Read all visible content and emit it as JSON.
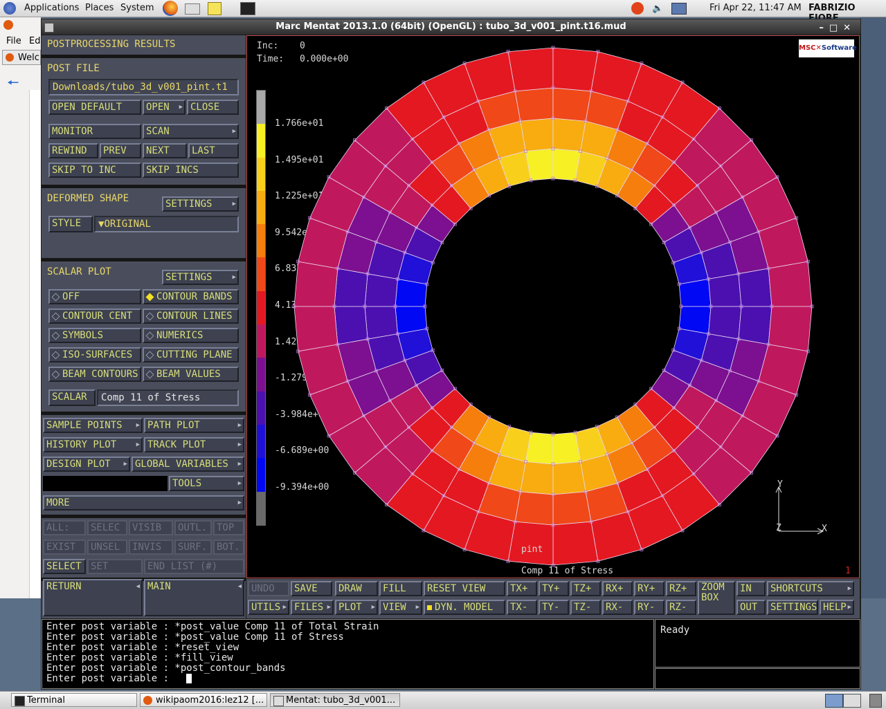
{
  "topbar": {
    "menus": [
      "Applications",
      "Places",
      "System"
    ],
    "datetime": "Fri Apr 22, 11:47 AM",
    "user": "FABRIZIO FIORE"
  },
  "bg_window": {
    "menu_file": "File",
    "menu_edit": "Ed",
    "tab": "Welc"
  },
  "window": {
    "title": "Marc Mentat 2013.1.0 (64bit) (OpenGL) : tubo_3d_v001_pint.t16.mud"
  },
  "panel": {
    "title": "POSTPROCESSING RESULTS",
    "post_file_label": "POST FILE",
    "post_file_path": "Downloads/tubo_3d_v001_pint.t1",
    "open_default": "OPEN DEFAULT",
    "open": "OPEN",
    "close": "CLOSE",
    "monitor": "MONITOR",
    "scan": "SCAN",
    "rewind": "REWIND",
    "prev": "PREV",
    "next": "NEXT",
    "last": "LAST",
    "skip_to_inc": "SKIP TO INC",
    "skip_incs": "SKIP INCS",
    "deformed_shape": "DEFORMED SHAPE",
    "settings": "SETTINGS",
    "style": "STYLE",
    "style_value": "ORIGINAL",
    "scalar_plot": "SCALAR PLOT",
    "off": "OFF",
    "contour_bands": "CONTOUR BANDS",
    "contour_cent": "CONTOUR CENT",
    "contour_lines": "CONTOUR LINES",
    "symbols": "SYMBOLS",
    "numerics": "NUMERICS",
    "iso_surfaces": "ISO-SURFACES",
    "cutting_plane": "CUTTING PLANE",
    "beam_contours": "BEAM CONTOURS",
    "beam_values": "BEAM VALUES",
    "scalar": "SCALAR",
    "scalar_value": "Comp 11 of Stress",
    "sample_points": "SAMPLE POINTS",
    "path_plot": "PATH PLOT",
    "history_plot": "HISTORY PLOT",
    "track_plot": "TRACK PLOT",
    "design_plot": "DESIGN PLOT",
    "global_variables": "GLOBAL VARIABLES",
    "tools": "TOOLS",
    "more": "MORE",
    "grid": [
      "ALL:",
      "SELEC",
      "VISIB",
      "OUTL.",
      "TOP",
      "EXIST",
      "UNSEL",
      "INVIS",
      "SURF.",
      "BOT."
    ],
    "select": "SELECT",
    "set": "SET",
    "end_list": "END LIST (#)",
    "return": "RETURN",
    "main": "MAIN"
  },
  "viewport": {
    "inc_label": "Inc:",
    "inc_value": "0",
    "time_label": "Time:",
    "time_value": "0.000e+00",
    "logo_msc": "MSC",
    "logo_software": "Software",
    "legend_labels": [
      "1.766e+01",
      "1.495e+01",
      "1.225e+01",
      "9.542e+00",
      "6.837e+00",
      "4.132e+00",
      "1.427e+00",
      "-1.279e+00",
      "-3.984e+00",
      "-6.689e+00",
      "-9.394e+00"
    ],
    "legend_colors": [
      "#a8a8a8",
      "#f6f024",
      "#f8d01c",
      "#f8ac10",
      "#f67e0c",
      "#f04818",
      "#e41820",
      "#c0185c",
      "#7c1090",
      "#4c10b0",
      "#2010d8",
      "#0008f4",
      "#6a6a6a"
    ],
    "set_name": "pint",
    "caption": "Comp 11 of Stress",
    "axis_y": "Y",
    "axis_z": "Z",
    "axis_x": "X",
    "corner_num": "1"
  },
  "toolbar": {
    "undo": "UNDO",
    "save": "SAVE",
    "draw": "DRAW",
    "fill": "FILL",
    "reset_view": "RESET VIEW",
    "txp": "TX+",
    "typ": "TY+",
    "tzp": "TZ+",
    "rxp": "RX+",
    "ryp": "RY+",
    "rzp": "RZ+",
    "zoom_box": "ZOOM BOX",
    "in": "IN",
    "shortcuts": "SHORTCUTS",
    "utils": "UTILS",
    "files": "FILES",
    "plot": "PLOT",
    "view": "VIEW",
    "dyn_model": "DYN. MODEL",
    "txm": "TX-",
    "tym": "TY-",
    "tzm": "TZ-",
    "rxm": "RX-",
    "rym": "RY-",
    "rzm": "RZ-",
    "out": "OUT",
    "settings": "SETTINGS",
    "help": "HELP"
  },
  "console": {
    "lines": [
      "Enter post variable : *post_value Comp 11 of Total Strain",
      "Enter post variable : *post_value Comp 11 of Stress",
      "Enter post variable : *reset_view",
      "Enter post variable : *fill_view",
      "Enter post variable : *post_contour_bands",
      "Enter post variable : "
    ],
    "status": "Ready"
  },
  "taskbar": {
    "items": [
      "Terminal",
      "wikipaom2016:lez12 [...",
      "Mentat: tubo_3d_v001..."
    ]
  }
}
